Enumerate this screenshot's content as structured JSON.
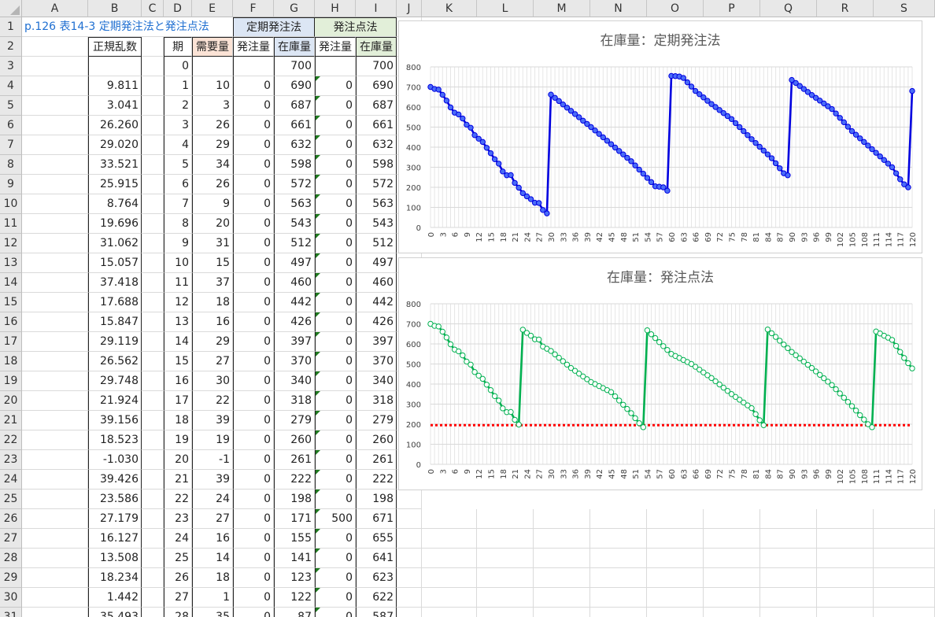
{
  "columns": [
    "A",
    "B",
    "C",
    "D",
    "E",
    "F",
    "G",
    "H",
    "I",
    "J",
    "K",
    "L",
    "M",
    "N",
    "O",
    "P",
    "Q",
    "R",
    "S"
  ],
  "title_cell": "p.126 表14-3 定期発注法と発注点法",
  "group_headers": {
    "teiki": "定期発注法",
    "hatchuten": "発注点法"
  },
  "headers": {
    "rand": "正規乱数",
    "period": "期",
    "demand": "需要量",
    "order1": "発注量",
    "stock1": "在庫量",
    "order2": "発注量",
    "stock2": "在庫量"
  },
  "rows": [
    {
      "r": "1"
    },
    {
      "r": "2"
    },
    {
      "r": "3",
      "b": "",
      "d": "0",
      "e": "",
      "f": "",
      "g": "700",
      "h": "",
      "i": "700"
    },
    {
      "r": "4",
      "b": "9.811",
      "d": "1",
      "e": "10",
      "f": "0",
      "g": "690",
      "h": "0",
      "i": "690"
    },
    {
      "r": "5",
      "b": "3.041",
      "d": "2",
      "e": "3",
      "f": "0",
      "g": "687",
      "h": "0",
      "i": "687"
    },
    {
      "r": "6",
      "b": "26.260",
      "d": "3",
      "e": "26",
      "f": "0",
      "g": "661",
      "h": "0",
      "i": "661"
    },
    {
      "r": "7",
      "b": "29.020",
      "d": "4",
      "e": "29",
      "f": "0",
      "g": "632",
      "h": "0",
      "i": "632"
    },
    {
      "r": "8",
      "b": "33.521",
      "d": "5",
      "e": "34",
      "f": "0",
      "g": "598",
      "h": "0",
      "i": "598"
    },
    {
      "r": "9",
      "b": "25.915",
      "d": "6",
      "e": "26",
      "f": "0",
      "g": "572",
      "h": "0",
      "i": "572"
    },
    {
      "r": "10",
      "b": "8.764",
      "d": "7",
      "e": "9",
      "f": "0",
      "g": "563",
      "h": "0",
      "i": "563"
    },
    {
      "r": "11",
      "b": "19.696",
      "d": "8",
      "e": "20",
      "f": "0",
      "g": "543",
      "h": "0",
      "i": "543"
    },
    {
      "r": "12",
      "b": "31.062",
      "d": "9",
      "e": "31",
      "f": "0",
      "g": "512",
      "h": "0",
      "i": "512"
    },
    {
      "r": "13",
      "b": "15.057",
      "d": "10",
      "e": "15",
      "f": "0",
      "g": "497",
      "h": "0",
      "i": "497"
    },
    {
      "r": "14",
      "b": "37.418",
      "d": "11",
      "e": "37",
      "f": "0",
      "g": "460",
      "h": "0",
      "i": "460"
    },
    {
      "r": "15",
      "b": "17.688",
      "d": "12",
      "e": "18",
      "f": "0",
      "g": "442",
      "h": "0",
      "i": "442"
    },
    {
      "r": "16",
      "b": "15.847",
      "d": "13",
      "e": "16",
      "f": "0",
      "g": "426",
      "h": "0",
      "i": "426"
    },
    {
      "r": "17",
      "b": "29.119",
      "d": "14",
      "e": "29",
      "f": "0",
      "g": "397",
      "h": "0",
      "i": "397"
    },
    {
      "r": "18",
      "b": "26.562",
      "d": "15",
      "e": "27",
      "f": "0",
      "g": "370",
      "h": "0",
      "i": "370"
    },
    {
      "r": "19",
      "b": "29.748",
      "d": "16",
      "e": "30",
      "f": "0",
      "g": "340",
      "h": "0",
      "i": "340"
    },
    {
      "r": "20",
      "b": "21.924",
      "d": "17",
      "e": "22",
      "f": "0",
      "g": "318",
      "h": "0",
      "i": "318"
    },
    {
      "r": "21",
      "b": "39.156",
      "d": "18",
      "e": "39",
      "f": "0",
      "g": "279",
      "h": "0",
      "i": "279"
    },
    {
      "r": "22",
      "b": "18.523",
      "d": "19",
      "e": "19",
      "f": "0",
      "g": "260",
      "h": "0",
      "i": "260"
    },
    {
      "r": "23",
      "b": "-1.030",
      "d": "20",
      "e": "-1",
      "f": "0",
      "g": "261",
      "h": "0",
      "i": "261"
    },
    {
      "r": "24",
      "b": "39.426",
      "d": "21",
      "e": "39",
      "f": "0",
      "g": "222",
      "h": "0",
      "i": "222"
    },
    {
      "r": "25",
      "b": "23.586",
      "d": "22",
      "e": "24",
      "f": "0",
      "g": "198",
      "h": "0",
      "i": "198"
    },
    {
      "r": "26",
      "b": "27.179",
      "d": "23",
      "e": "27",
      "f": "0",
      "g": "171",
      "h": "500",
      "i": "671"
    },
    {
      "r": "27",
      "b": "16.127",
      "d": "24",
      "e": "16",
      "f": "0",
      "g": "155",
      "h": "0",
      "i": "655"
    },
    {
      "r": "28",
      "b": "13.508",
      "d": "25",
      "e": "14",
      "f": "0",
      "g": "141",
      "h": "0",
      "i": "641"
    },
    {
      "r": "29",
      "b": "18.234",
      "d": "26",
      "e": "18",
      "f": "0",
      "g": "123",
      "h": "0",
      "i": "623"
    },
    {
      "r": "30",
      "b": "1.442",
      "d": "27",
      "e": "1",
      "f": "0",
      "g": "122",
      "h": "0",
      "i": "622"
    },
    {
      "r": "31",
      "b": "35.493",
      "d": "28",
      "e": "35",
      "f": "0",
      "g": "87",
      "h": "0",
      "i": "587"
    }
  ],
  "chart_data": [
    {
      "type": "line",
      "title": "在庫量：定期発注法",
      "color": "#0000e0",
      "marker_fill": "#4a6cf7",
      "ylim": [
        0,
        800
      ],
      "yticks": [
        0,
        100,
        200,
        300,
        400,
        500,
        600,
        700,
        800
      ],
      "xlim": [
        0,
        120
      ],
      "xtick_step": 3,
      "keypoints": [
        [
          0,
          700
        ],
        [
          1,
          690
        ],
        [
          2,
          687
        ],
        [
          3,
          661
        ],
        [
          4,
          632
        ],
        [
          5,
          598
        ],
        [
          6,
          572
        ],
        [
          7,
          563
        ],
        [
          8,
          543
        ],
        [
          9,
          512
        ],
        [
          10,
          497
        ],
        [
          11,
          460
        ],
        [
          12,
          442
        ],
        [
          13,
          426
        ],
        [
          14,
          397
        ],
        [
          15,
          370
        ],
        [
          16,
          340
        ],
        [
          17,
          318
        ],
        [
          18,
          279
        ],
        [
          19,
          260
        ],
        [
          20,
          261
        ],
        [
          21,
          222
        ],
        [
          22,
          198
        ],
        [
          23,
          171
        ],
        [
          24,
          155
        ],
        [
          25,
          141
        ],
        [
          26,
          123
        ],
        [
          27,
          122
        ],
        [
          28,
          87
        ],
        [
          29,
          70
        ],
        [
          30,
          662
        ],
        [
          40,
          500
        ],
        [
          50,
          330
        ],
        [
          56,
          205
        ],
        [
          58,
          200
        ],
        [
          59,
          183
        ],
        [
          60,
          755
        ],
        [
          62,
          752
        ],
        [
          63,
          745
        ],
        [
          66,
          680
        ],
        [
          70,
          615
        ],
        [
          75,
          540
        ],
        [
          80,
          440
        ],
        [
          85,
          345
        ],
        [
          88,
          270
        ],
        [
          89,
          260
        ],
        [
          90,
          735
        ],
        [
          95,
          660
        ],
        [
          100,
          590
        ],
        [
          105,
          480
        ],
        [
          110,
          390
        ],
        [
          115,
          300
        ],
        [
          117,
          240
        ],
        [
          118,
          215
        ],
        [
          119,
          200
        ],
        [
          120,
          680
        ]
      ]
    },
    {
      "type": "line",
      "title": "在庫量：発注点法",
      "color": "#00b050",
      "marker_fill": "#ffffff",
      "ylim": [
        0,
        800
      ],
      "yticks": [
        0,
        100,
        200,
        300,
        400,
        500,
        600,
        700,
        800
      ],
      "xlim": [
        0,
        120
      ],
      "xtick_step": 3,
      "reorder_point": 195,
      "reorder_color": "#ff0000",
      "keypoints": [
        [
          0,
          700
        ],
        [
          1,
          690
        ],
        [
          2,
          687
        ],
        [
          3,
          661
        ],
        [
          4,
          632
        ],
        [
          5,
          598
        ],
        [
          6,
          572
        ],
        [
          7,
          563
        ],
        [
          8,
          543
        ],
        [
          9,
          512
        ],
        [
          10,
          497
        ],
        [
          11,
          460
        ],
        [
          12,
          442
        ],
        [
          13,
          426
        ],
        [
          14,
          397
        ],
        [
          15,
          370
        ],
        [
          16,
          340
        ],
        [
          17,
          318
        ],
        [
          18,
          279
        ],
        [
          19,
          260
        ],
        [
          20,
          261
        ],
        [
          21,
          222
        ],
        [
          22,
          198
        ],
        [
          23,
          671
        ],
        [
          24,
          655
        ],
        [
          25,
          641
        ],
        [
          26,
          623
        ],
        [
          27,
          622
        ],
        [
          28,
          587
        ],
        [
          30,
          565
        ],
        [
          35,
          480
        ],
        [
          40,
          410
        ],
        [
          45,
          360
        ],
        [
          50,
          255
        ],
        [
          52,
          205
        ],
        [
          53,
          185
        ],
        [
          54,
          668
        ],
        [
          60,
          550
        ],
        [
          65,
          500
        ],
        [
          70,
          430
        ],
        [
          75,
          350
        ],
        [
          80,
          280
        ],
        [
          82,
          220
        ],
        [
          83,
          195
        ],
        [
          84,
          672
        ],
        [
          90,
          560
        ],
        [
          95,
          480
        ],
        [
          100,
          395
        ],
        [
          105,
          290
        ],
        [
          109,
          200
        ],
        [
          110,
          185
        ],
        [
          111,
          662
        ],
        [
          115,
          620
        ],
        [
          118,
          530
        ],
        [
          120,
          478
        ]
      ]
    }
  ]
}
